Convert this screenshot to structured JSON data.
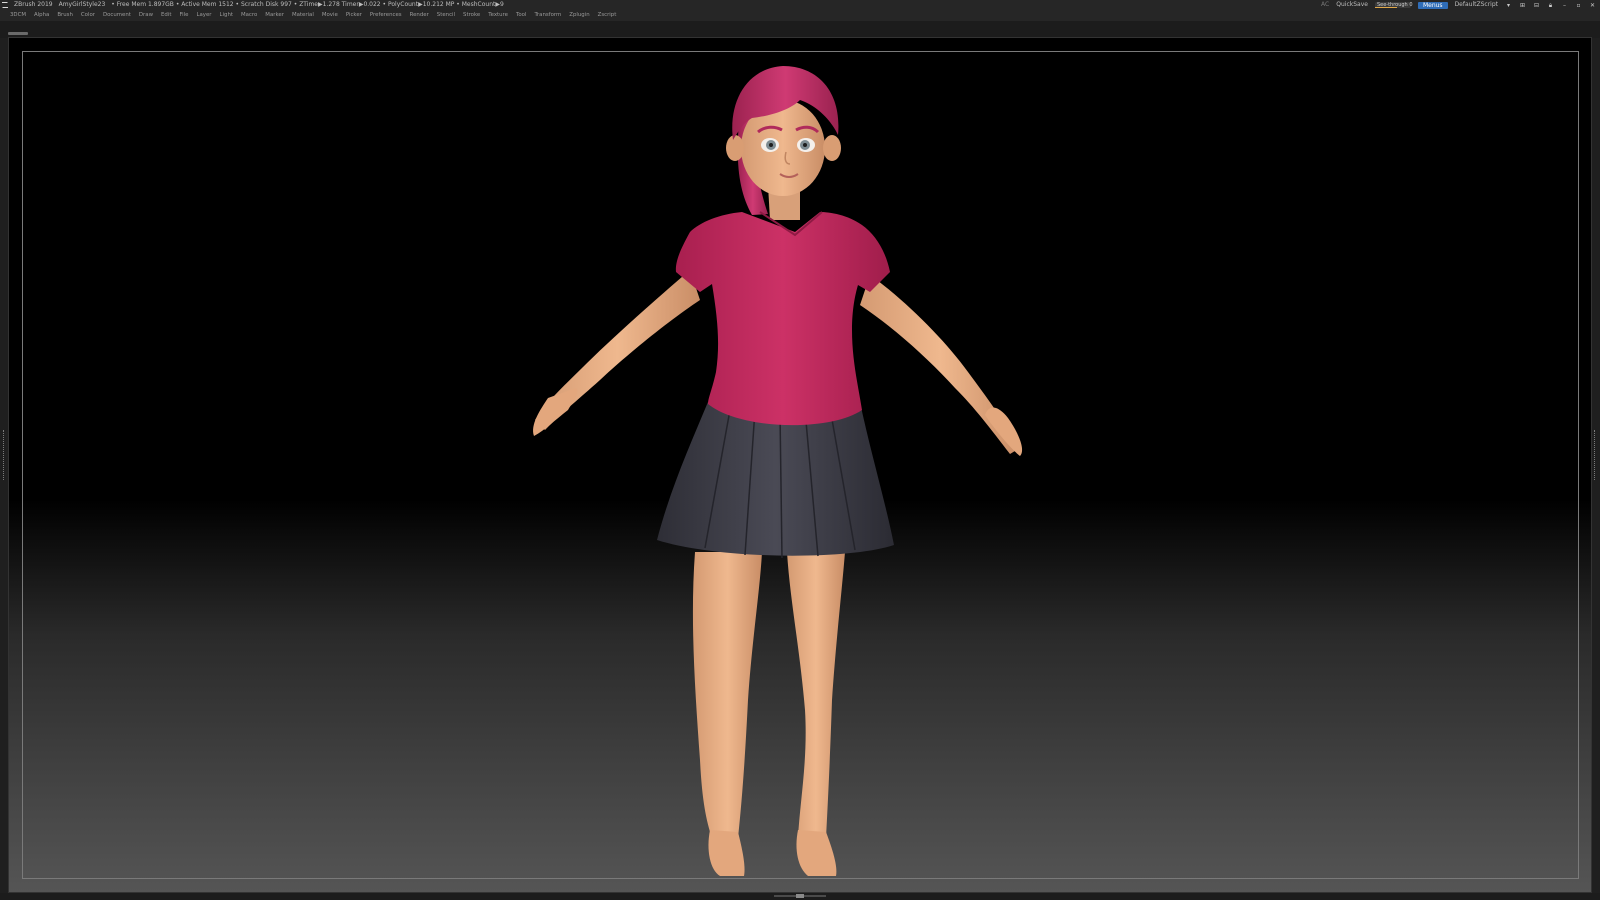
{
  "titlebar": {
    "app": "ZBrush 2019",
    "document": "AmyGirlStyle23",
    "stats": "• Free Mem 1.897GB • Active Mem 1512 • Scratch Disk 997 • ZTime▶1.278 Timer▶0.022 • PolyCount▶10.212 MP • MeshCount▶9",
    "ac": "AC",
    "quicksave": "QuickSave",
    "see_through": "See-through 0",
    "menus_button": "Menus",
    "default_script": "DefaultZScript"
  },
  "menubar": {
    "items": [
      "3DCM",
      "Alpha",
      "Brush",
      "Color",
      "Document",
      "Draw",
      "Edit",
      "File",
      "Layer",
      "Light",
      "Macro",
      "Marker",
      "Material",
      "Movie",
      "Picker",
      "Preferences",
      "Render",
      "Stencil",
      "Stroke",
      "Texture",
      "Tool",
      "Transform",
      "Zplugin",
      "Zscript"
    ]
  },
  "colors": {
    "hair": "#c2336a",
    "shirt": "#c42a5e",
    "skin": "#e9b086",
    "skirt": "#3e3e48"
  }
}
